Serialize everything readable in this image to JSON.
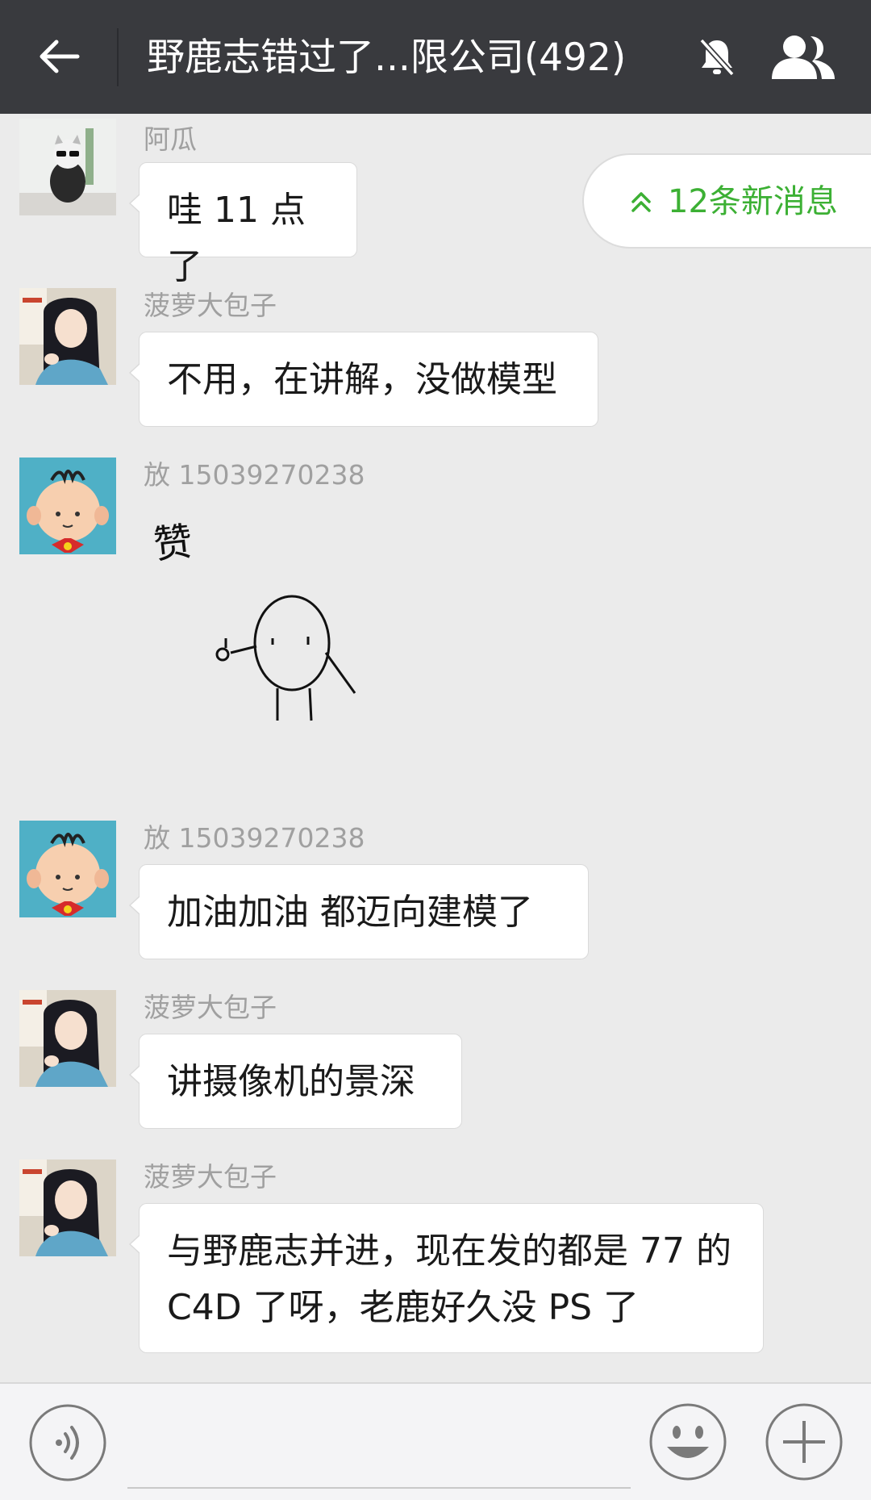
{
  "header": {
    "title": "野鹿志错过了...限公司(492)",
    "back_icon": "arrow-left-icon",
    "mute_icon": "bell-muted-icon",
    "members_icon": "group-icon"
  },
  "new_messages": {
    "label": "12条新消息",
    "icon": "double-chevron-up-icon",
    "color": "#3cb034"
  },
  "messages": [
    {
      "sender": "阿瓜",
      "text": "哇 11 点了",
      "avatar": "avatar-cat"
    },
    {
      "sender": "菠萝大包子",
      "text": "不用，在讲解，没做模型",
      "avatar": "avatar-anime-girl"
    },
    {
      "sender": "放 15039270238",
      "sticker_text": "赞",
      "avatar": "avatar-cartoon-boy"
    },
    {
      "sender": "放 15039270238",
      "text": "加油加油 都迈向建模了",
      "avatar": "avatar-cartoon-boy"
    },
    {
      "sender": "菠萝大包子",
      "text": "讲摄像机的景深",
      "avatar": "avatar-anime-girl"
    },
    {
      "sender": "菠萝大包子",
      "text_line1": "与野鹿志并进，现在发的都是 77 的",
      "text_line2": "C4D 了呀，老鹿好久没 PS 了",
      "avatar": "avatar-anime-girl"
    }
  ],
  "bottom_bar": {
    "voice_icon": "voice-icon",
    "emoji_icon": "smiley-icon",
    "plus_icon": "plus-icon",
    "input_placeholder": ""
  },
  "colors": {
    "header_bg": "#393a3e",
    "chat_bg": "#ebebeb",
    "bubble_bg": "#ffffff",
    "sender_text": "#a0a0a0",
    "accent_green": "#3cb034"
  }
}
